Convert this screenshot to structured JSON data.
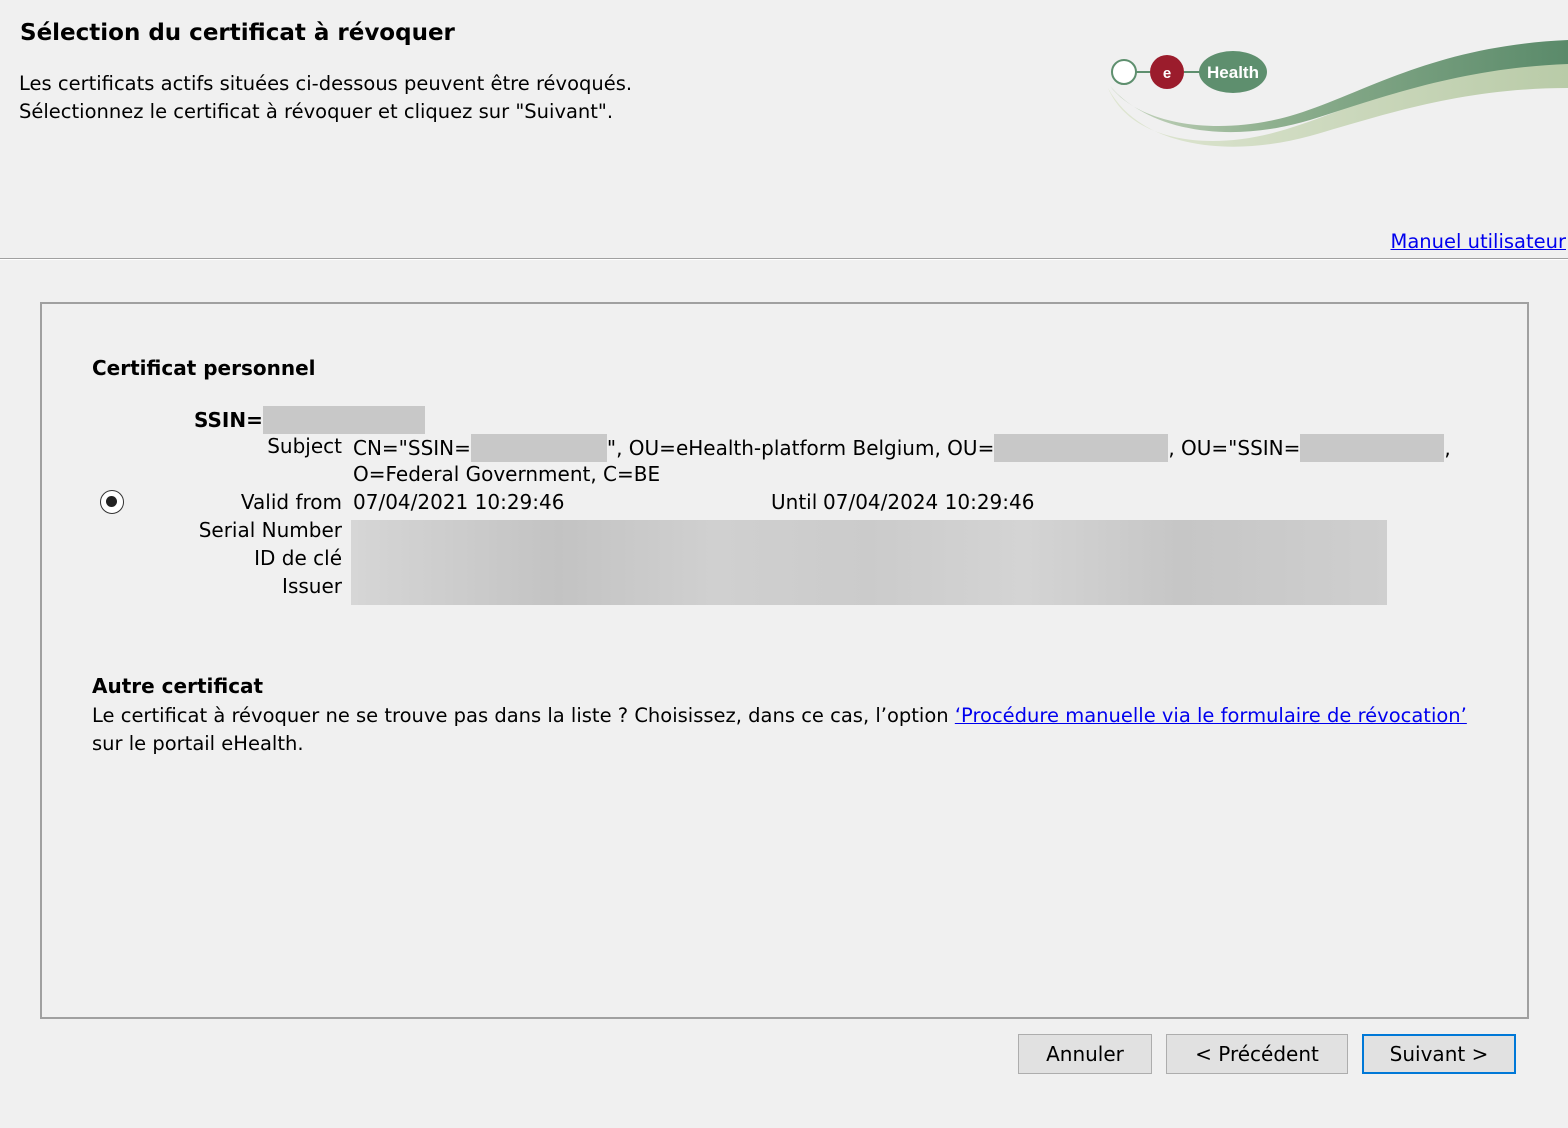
{
  "header": {
    "title": "Sélection du certificat à révoquer",
    "desc_line1": "Les certificats actifs situées ci-dessous peuvent être révoqués.",
    "desc_line2": "Sélectionnez le certificat à révoquer et cliquez sur \"Suivant\".",
    "logo_text": "Health",
    "logo_e": "e",
    "manual_link": "Manuel utilisateur"
  },
  "personal": {
    "section_title": "Certificat personnel",
    "selected": true,
    "cert_name_prefix": "SSIN=",
    "labels": {
      "subject": "Subject",
      "valid_from": "Valid from",
      "until": "Until",
      "serial": "Serial Number",
      "key_id": "ID de clé",
      "issuer": "Issuer"
    },
    "subject_seg1": "CN=\"SSIN=",
    "subject_seg2": "\", OU=eHealth-platform Belgium, OU=",
    "subject_seg3": ", OU=\"SSIN=",
    "subject_seg4": ",",
    "subject_line2": "O=Federal Government, C=BE",
    "valid_from": "07/04/2021 10:29:46",
    "until": "07/04/2024 10:29:46"
  },
  "other": {
    "section_title": "Autre certificat",
    "text_before": "Le certificat à révoquer ne se trouve pas dans la liste ? Choisissez, dans ce cas, l’option ",
    "link": "‘Procédure manuelle via le formulaire de révocation’",
    "text_after": " sur le portail eHealth."
  },
  "buttons": {
    "cancel": "Annuler",
    "previous": "< Précédent",
    "next": "Suivant >"
  },
  "colors": {
    "link": "#0000ee",
    "logo_green": "#5e8f6e",
    "logo_red": "#9b1c2c",
    "default_button_border": "#0078d7"
  }
}
